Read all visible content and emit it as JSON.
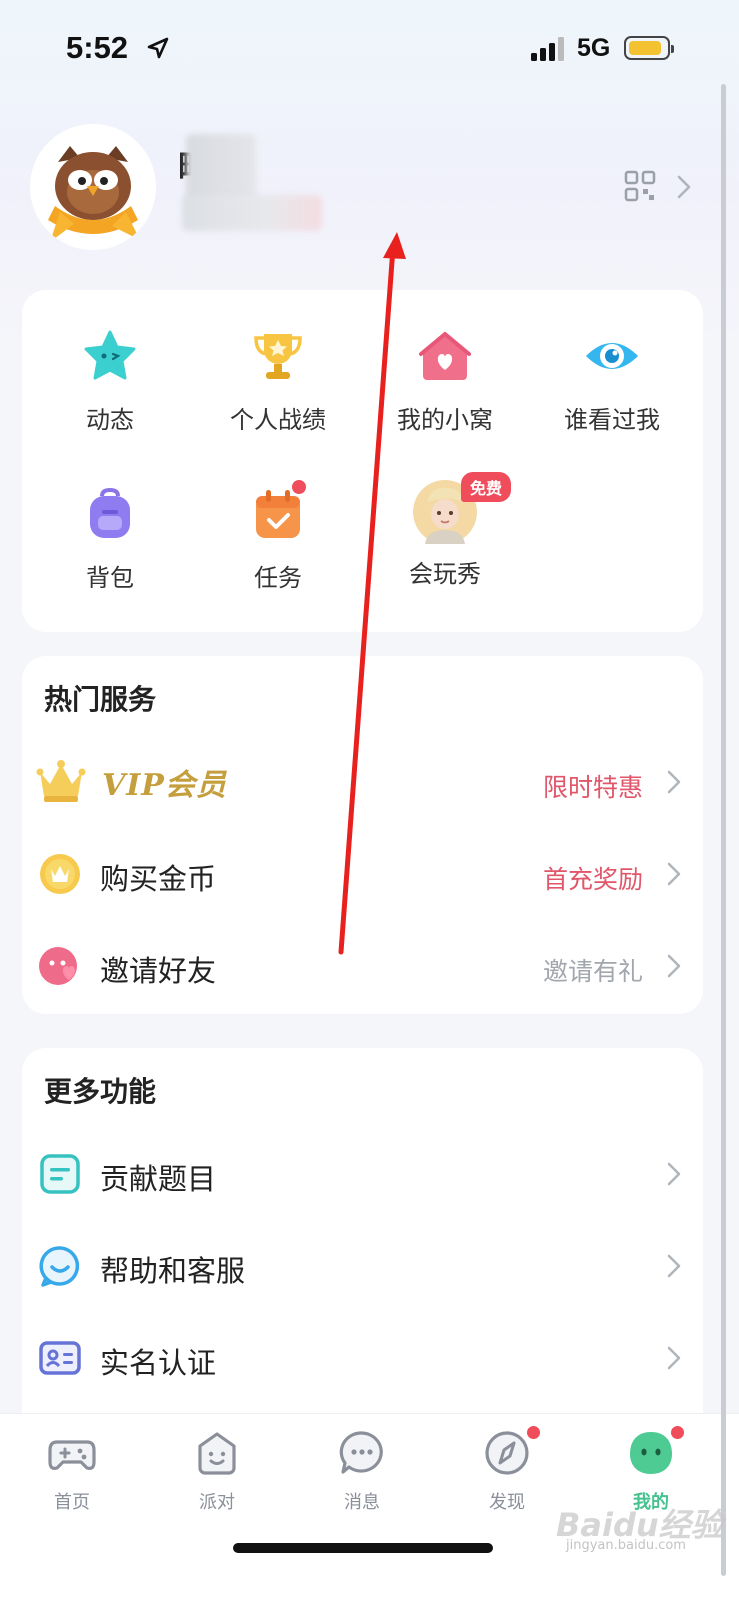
{
  "status_bar": {
    "time": "5:52",
    "network": "5G"
  },
  "profile": {
    "name_visible": "毗",
    "qr_icon": "qr-code-icon"
  },
  "features": [
    {
      "label": "动态",
      "icon": "star-face-icon"
    },
    {
      "label": "个人战绩",
      "icon": "trophy-icon"
    },
    {
      "label": "我的小窝",
      "icon": "house-heart-icon"
    },
    {
      "label": "谁看过我",
      "icon": "eye-icon"
    },
    {
      "label": "背包",
      "icon": "backpack-icon"
    },
    {
      "label": "任务",
      "icon": "task-calendar-icon"
    },
    {
      "label": "会玩秀",
      "icon": "avatar-show-icon",
      "badge": "免费"
    }
  ],
  "hot_services": {
    "title": "热门服务",
    "items": [
      {
        "label": "VIP会员",
        "value": "限时特惠",
        "icon": "crown-icon"
      },
      {
        "label": "购买金币",
        "value": "首充奖励",
        "icon": "coin-icon"
      },
      {
        "label": "邀请好友",
        "value": "邀请有礼",
        "icon": "invite-friend-icon"
      }
    ]
  },
  "more_functions": {
    "title": "更多功能",
    "items": [
      {
        "label": "贡献题目",
        "icon": "document-icon"
      },
      {
        "label": "帮助和客服",
        "icon": "customer-service-icon"
      },
      {
        "label": "实名认证",
        "icon": "id-card-icon"
      }
    ]
  },
  "tabbar": [
    {
      "label": "首页",
      "icon": "gamepad-icon"
    },
    {
      "label": "派对",
      "icon": "party-icon"
    },
    {
      "label": "消息",
      "icon": "message-icon"
    },
    {
      "label": "发现",
      "icon": "compass-icon"
    },
    {
      "label": "我的",
      "icon": "me-icon",
      "active": true
    }
  ],
  "watermark": {
    "text": "Baidu经验",
    "sub": "jingyan.baidu.com"
  },
  "colors": {
    "accent_red": "#e0566a",
    "active_green": "#45c28f",
    "vip_gold": "#c59f3d"
  }
}
